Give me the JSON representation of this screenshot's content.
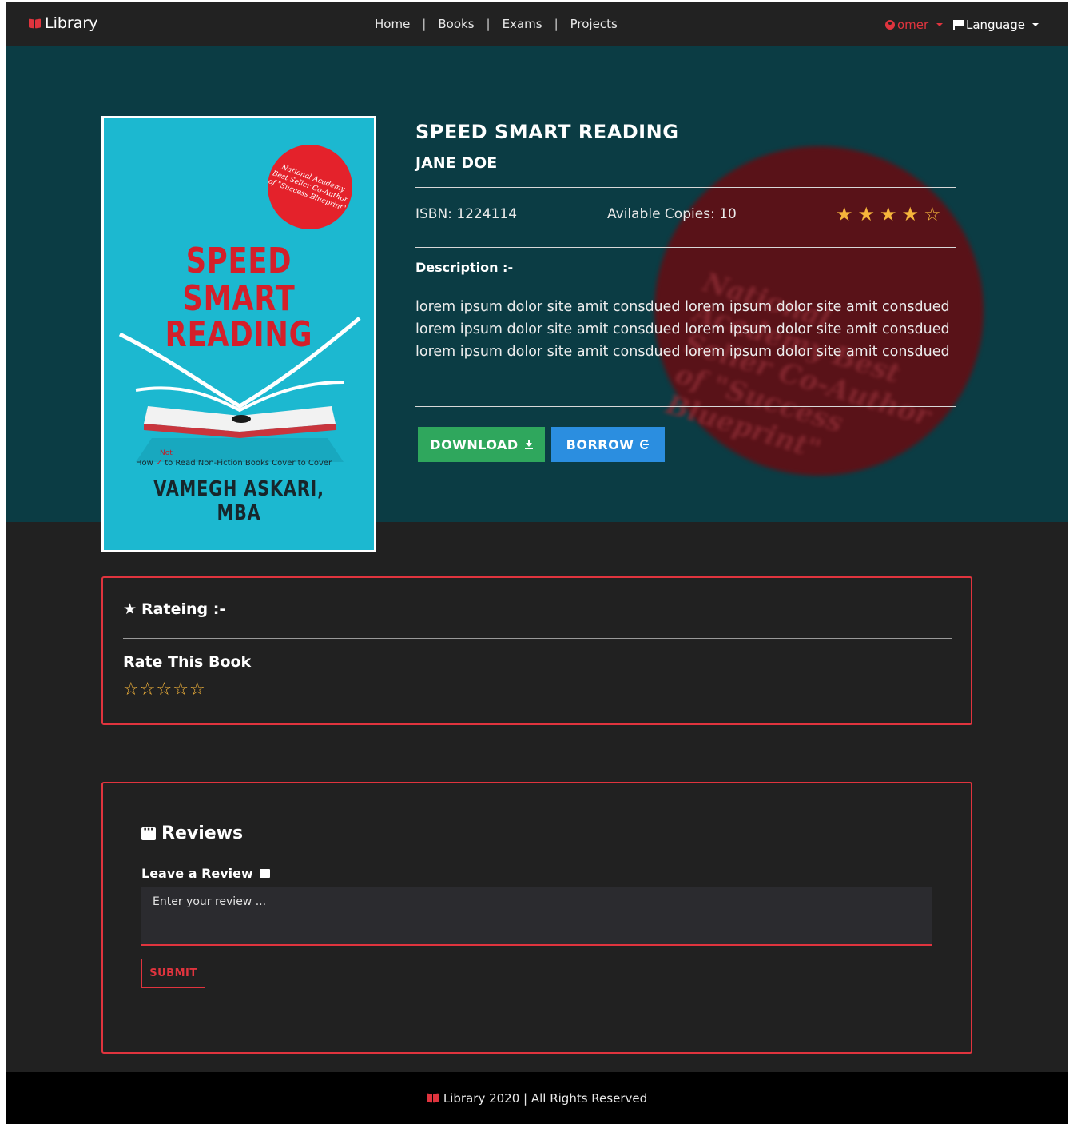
{
  "navbar": {
    "brand": "Library",
    "links": [
      "Home",
      "Books",
      "Exams",
      "Projects"
    ],
    "separator": "|",
    "user": "omer",
    "language": "Language"
  },
  "book": {
    "title": "SPEED SMART READING",
    "author": "JANE DOE",
    "isbn": "ISBN: 1224114",
    "copies": "Avilable Copies: 10",
    "rating": 4,
    "rating_max": 5,
    "description_label": "Description :-",
    "description": "lorem ipsum dolor site amit consdued lorem ipsum dolor site amit consdued lorem ipsum dolor site amit consdued lorem ipsum dolor site amit consdued lorem ipsum dolor site amit consdued lorem ipsum dolor site amit consdued",
    "download_label": "DOWNLOAD",
    "borrow_label": "BORROW",
    "cover": {
      "badge": "National Academy Best Seller Co-Author of \"Success Blueprint\"",
      "title_lines": [
        "SPEED",
        "SMART",
        "READING"
      ],
      "tagline_how": "How",
      "tagline_not": "Not",
      "tagline_rest": "to Read Non-Fiction Books Cover to Cover",
      "author": "VAMEGH ASKARI, MBA"
    },
    "seal_text": "National Academy Best Seller Co-Author of \"Success Blueprint\""
  },
  "rating_panel": {
    "title": "Rateing :-",
    "rate_label": "Rate This Book",
    "stars": 5
  },
  "reviews": {
    "title": "Reviews",
    "leave_label": "Leave a Review",
    "placeholder": "Enter your review ...",
    "submit_label": "SUBMIT"
  },
  "footer": {
    "text": "Library 2020 | All Rights Reserved"
  },
  "colors": {
    "accent": "#e0343e",
    "hero_bg": "#0b3c44",
    "page_bg": "#212121",
    "download": "#2fa75d",
    "borrow": "#2b8ee0",
    "star": "#f5b53b"
  }
}
